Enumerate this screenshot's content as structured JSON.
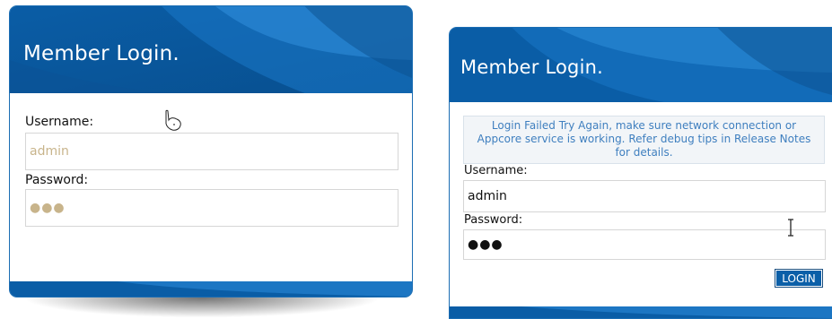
{
  "colors": {
    "brand_blue": "#0a5da6",
    "header_highlight": "#2d8fe0",
    "placeholder_text": "#c8b48b",
    "error_text": "#3f7fbf"
  },
  "left_panel": {
    "title": "Member Login.",
    "username_label": "Username:",
    "username_value": "admin",
    "password_label": "Password:",
    "password_value": "●●●"
  },
  "right_panel": {
    "title": "Member Login.",
    "error_message": "Login Failed Try Again, make sure network connection or Appcore service is working. Refer debug tips in Release Notes for details.",
    "username_label": "Username:",
    "username_value": "admin",
    "password_label": "Password:",
    "password_value": "●●●",
    "login_button": "LOGIN"
  },
  "icons": {
    "left_cursor": "hand-pointer-icon",
    "right_cursor": "text-cursor-icon"
  }
}
